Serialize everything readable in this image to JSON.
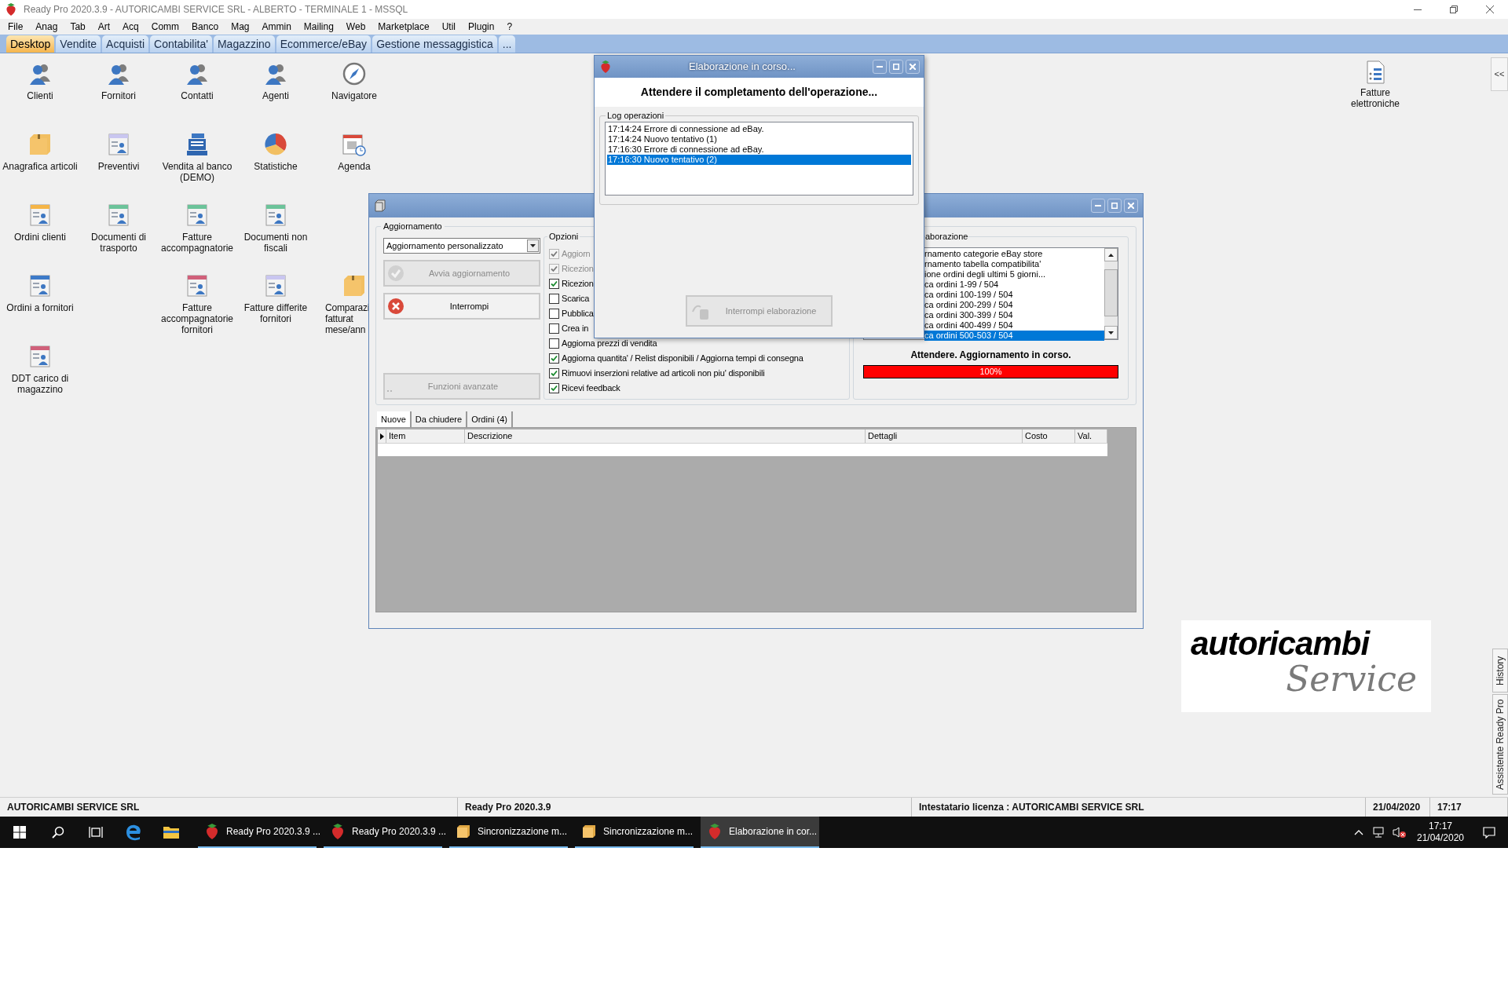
{
  "window": {
    "title": "Ready Pro 2020.3.9 - AUTORICAMBI SERVICE SRL - ALBERTO - TERMINALE 1 - MSSQL"
  },
  "menu": [
    "File",
    "Anag",
    "Tab",
    "Art",
    "Acq",
    "Comm",
    "Banco",
    "Mag",
    "Ammin",
    "Mailing",
    "Web",
    "Marketplace",
    "Util",
    "Plugin",
    "?"
  ],
  "tabs": [
    {
      "label": "Desktop",
      "selected": true
    },
    {
      "label": "Vendite",
      "selected": false
    },
    {
      "label": "Acquisti",
      "selected": false
    },
    {
      "label": "Contabilita'",
      "selected": false
    },
    {
      "label": "Magazzino",
      "selected": false
    },
    {
      "label": "Ecommerce/eBay",
      "selected": false
    },
    {
      "label": "Gestione messaggistica",
      "selected": false
    },
    {
      "label": "...",
      "selected": false
    }
  ],
  "desktop_icon_rows": [
    [
      {
        "label": "Clienti",
        "kind": "person"
      },
      {
        "label": "Fornitori",
        "kind": "person"
      },
      {
        "label": "Contatti",
        "kind": "person"
      },
      {
        "label": "Agenti",
        "kind": "person"
      },
      {
        "label": "Navigatore",
        "kind": "compass"
      }
    ],
    [
      {
        "label": "Anagrafica articoli",
        "kind": "box"
      },
      {
        "label": "Preventivi",
        "kind": "document",
        "color": "#c9c6f0"
      },
      {
        "label": "Vendita al banco (DEMO)",
        "kind": "register"
      },
      {
        "label": "Statistiche",
        "kind": "pie"
      },
      {
        "label": "Agenda",
        "kind": "calendar"
      }
    ],
    [
      {
        "label": "Ordini clienti",
        "kind": "document",
        "color": "#f5b547"
      },
      {
        "label": "Documenti di trasporto",
        "kind": "document",
        "color": "#6cc39a"
      },
      {
        "label": "Fatture accompagnatorie",
        "kind": "document",
        "color": "#6cc39a"
      },
      {
        "label": "Documenti non fiscali",
        "kind": "document",
        "color": "#6cc39a"
      }
    ],
    [
      {
        "label": "Ordini a fornitori",
        "kind": "document",
        "color": "#3d7ac8"
      },
      null,
      {
        "label": "Fatture accompagnatorie fornitori",
        "kind": "document",
        "color": "#d0607a"
      },
      {
        "label": "Fatture differite fornitori",
        "kind": "document",
        "color": "#c9c6f0"
      },
      {
        "label": "Comparazi\nfatturat\nmese/ann",
        "kind": "box",
        "partly_hidden": true
      }
    ],
    [
      {
        "label": "DDT carico di magazzino",
        "kind": "document",
        "color": "#d0607a"
      }
    ]
  ],
  "side_icon": {
    "label": "Fatture elettroniche"
  },
  "collapse_button": "<<",
  "main_window": {
    "group_label": "Aggiornamento",
    "mode_select": {
      "value": "Aggiornamento personalizzato"
    },
    "buttons": [
      {
        "label": "Avvia aggiornamento",
        "kind": "start",
        "disabled": true
      },
      {
        "label": "Interrompi",
        "kind": "stop",
        "disabled": false
      },
      {
        "label": "Funzioni avanzate",
        "kind": "more",
        "disabled": true
      }
    ],
    "options": {
      "label": "Opzioni",
      "items": [
        {
          "label": "Aggiorn",
          "checked": true,
          "disabled": true
        },
        {
          "label": "Ricezion",
          "checked": true,
          "disabled": true
        },
        {
          "label": "Ricezion",
          "checked": true,
          "disabled": false
        },
        {
          "label": "Scarica",
          "checked": false,
          "disabled": false
        },
        {
          "label": "Pubblica",
          "checked": false,
          "disabled": false
        },
        {
          "label": "Crea in",
          "checked": false,
          "disabled": false
        },
        {
          "label": "Aggiorna prezzi di vendita",
          "checked": false,
          "disabled": false
        },
        {
          "label": "Aggiorna quantita' / Relist disponibili / Aggiorna tempi di consegna",
          "checked": true,
          "disabled": false
        },
        {
          "label": "Rimuovi inserzioni relative ad articoli non piu' disponibili",
          "checked": true,
          "disabled": false
        },
        {
          "label": "Ricevi feedback",
          "checked": true,
          "disabled": false
        }
      ]
    },
    "progress_group": {
      "label": "aborazione",
      "log": [
        {
          "text": "rnamento categorie eBay store",
          "selected": false
        },
        {
          "text": "rnamento tabella compatibilita'",
          "selected": false
        },
        {
          "text": "ione ordini degli ultimi 5 giorni...",
          "selected": false
        },
        {
          "text": "ca ordini 1-99 / 504",
          "selected": false
        },
        {
          "text": "ca ordini 100-199 / 504",
          "selected": false
        },
        {
          "text": "ca ordini 200-299 / 504",
          "selected": false
        },
        {
          "text": "ca ordini 300-399 / 504",
          "selected": false
        },
        {
          "text": "ca ordini 400-499 / 504",
          "selected": false
        },
        {
          "text": "ca ordini 500-503 / 504",
          "selected": true
        }
      ],
      "status": "Attendere. Aggiornamento in corso.",
      "level": 1,
      "reading": "100%"
    },
    "tabs": [
      {
        "label": "Nuove",
        "selected": true
      },
      {
        "label": "Da chiudere",
        "selected": false
      },
      {
        "label": "Ordini (4)",
        "selected": false
      }
    ],
    "table": {
      "columns": [
        "Item",
        "Descrizione",
        "Dettagli",
        "Costo",
        "Val."
      ]
    }
  },
  "dialog": {
    "title": "Elaborazione in corso...",
    "heading": "Attendere il completamento dell'operazione...",
    "group_label": "Log operazioni",
    "log": [
      {
        "text": "17:14:24 Errore di connessione ad eBay.",
        "selected": false
      },
      {
        "text": "17:14:24 Nuovo tentativo (1)",
        "selected": false
      },
      {
        "text": "17:16:30 Errore di connessione ad eBay.",
        "selected": false
      },
      {
        "text": "17:16:30 Nuovo tentativo (2)",
        "selected": true
      }
    ],
    "button": {
      "label": "Interrompi elaborazione",
      "disabled": true
    }
  },
  "logo": {
    "line_1": "autoricambi",
    "line_2": "Service"
  },
  "side_tabs": [
    {
      "label": "History"
    },
    {
      "label": "Assistente Ready Pro"
    }
  ],
  "status_bar": [
    "AUTORICAMBI SERVICE SRL",
    "Ready Pro 2020.3.9",
    "Intestatario licenza : AUTORICAMBI SERVICE SRL",
    "21/04/2020",
    "17:17"
  ],
  "taskbar": {
    "apps": [
      {
        "label": "Ready Pro 2020.3.9 ...",
        "kind": "strawberry",
        "selected": false
      },
      {
        "label": "Ready Pro 2020.3.9 ...",
        "kind": "strawberry",
        "selected": false
      },
      {
        "label": "Sincronizzazione m...",
        "kind": "box",
        "selected": false
      },
      {
        "label": "Sincronizzazione m...",
        "kind": "box",
        "selected": false
      },
      {
        "label": "Elaborazione in cor...",
        "kind": "strawberry",
        "selected": true
      }
    ],
    "time": "17:17",
    "date": "21/04/2020"
  }
}
